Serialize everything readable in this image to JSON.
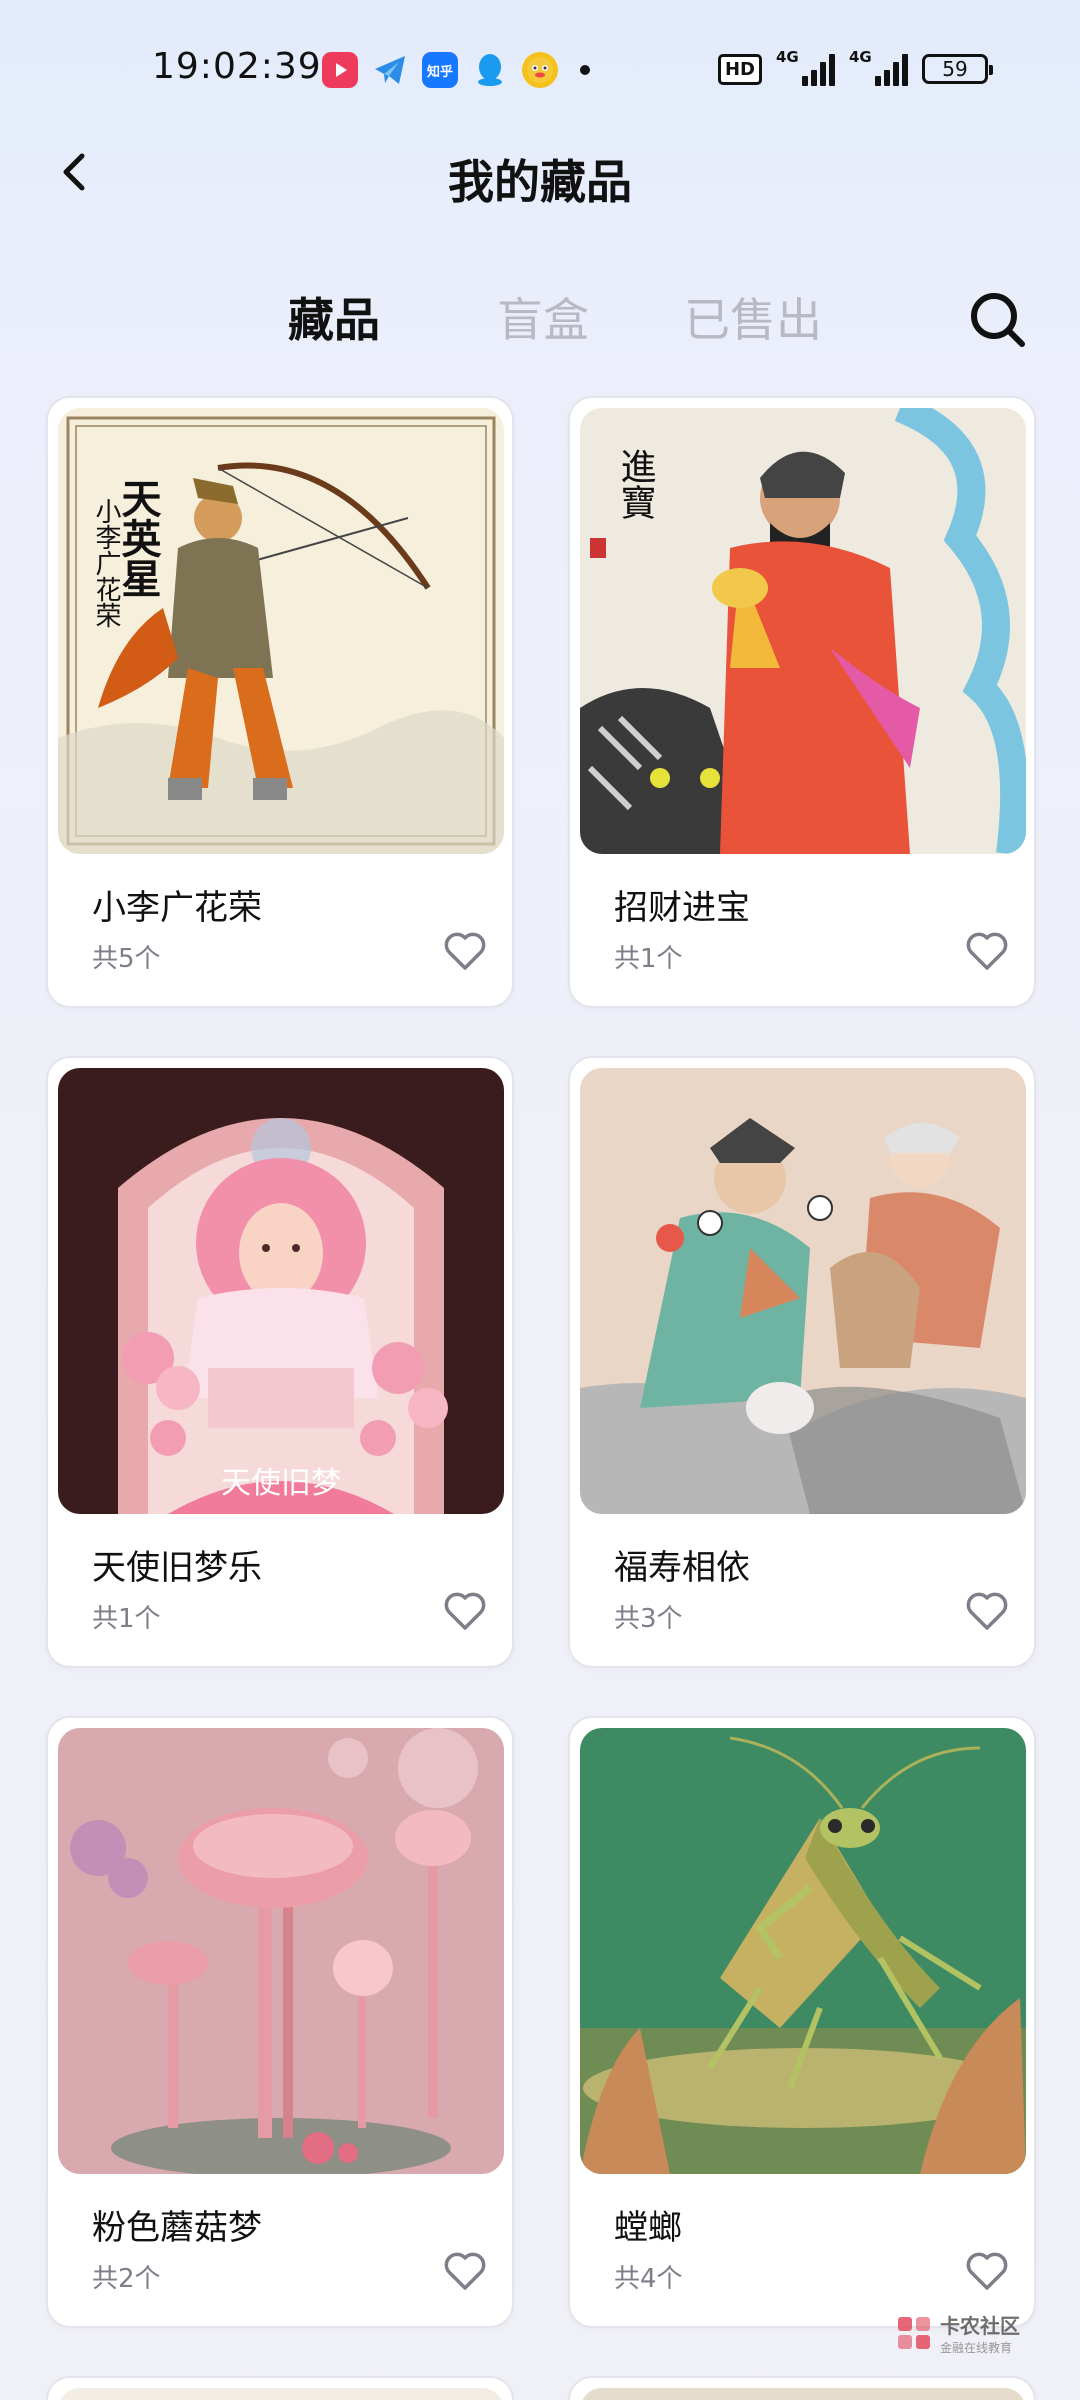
{
  "status_bar": {
    "time": "19:02:39",
    "apps": [
      "video-app-icon",
      "telegram-icon",
      "zhihu-icon",
      "qq-icon",
      "tieba-icon"
    ],
    "zhihu_label": "知乎",
    "hd_label": "HD",
    "signal_label_1": "4G",
    "signal_label_2": "4G",
    "battery": "59"
  },
  "header": {
    "title": "我的藏品"
  },
  "tabs": [
    {
      "label": "藏品",
      "active": true
    },
    {
      "label": "盲盒",
      "active": false
    },
    {
      "label": "已售出",
      "active": false
    }
  ],
  "items": [
    {
      "name": "小李广花荣",
      "count": "共5个",
      "image": "archer-painting"
    },
    {
      "name": "招财进宝",
      "count": "共1个",
      "image": "deity-tiger-painting"
    },
    {
      "name": "天使旧梦乐",
      "count": "共1个",
      "image": "pink-girl-illustration",
      "image_text": "天使旧梦"
    },
    {
      "name": "福寿相依",
      "count": "共3个",
      "image": "two-immortals-painting"
    },
    {
      "name": "粉色蘑菇梦",
      "count": "共2个",
      "image": "pink-mushroom-render"
    },
    {
      "name": "螳螂",
      "count": "共4个",
      "image": "mantis-render"
    }
  ],
  "archer_text": {
    "line1": "天英星",
    "line2": "小李广花荣"
  },
  "deity_text": {
    "line1": "進寶"
  },
  "watermark": {
    "title": "卡农社区",
    "subtitle": "金融在线教育"
  }
}
